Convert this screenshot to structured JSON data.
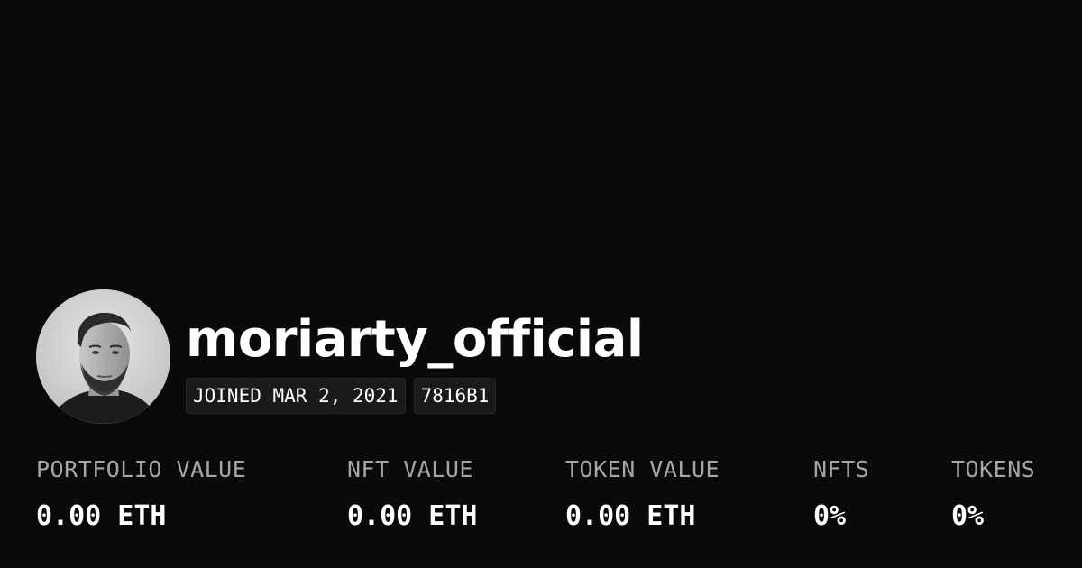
{
  "profile": {
    "username": "moriarty_official",
    "joined": "JOINED MAR 2, 2021",
    "code": "7816B1",
    "avatar": "avatar-photo"
  },
  "stats": [
    {
      "label": "PORTFOLIO VALUE",
      "value": "0.00 ETH"
    },
    {
      "label": "NFT VALUE",
      "value": "0.00 ETH"
    },
    {
      "label": "TOKEN VALUE",
      "value": "0.00 ETH"
    },
    {
      "label": "NFTS",
      "value": "0%"
    },
    {
      "label": "TOKENS",
      "value": "0%"
    }
  ],
  "colors": {
    "background": "#0a0a0a",
    "text": "#ffffff",
    "muted": "#a6a6a6",
    "badge_bg": "#1a1a1a"
  }
}
